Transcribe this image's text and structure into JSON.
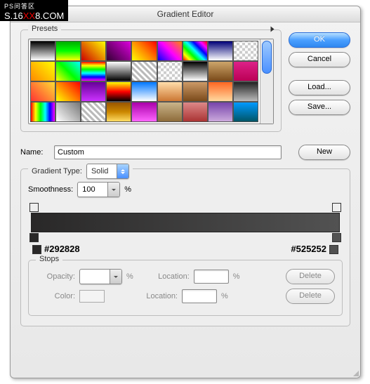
{
  "watermark": {
    "top": "PS问答区",
    "bottom_a": "S.16",
    "bottom_b": "XX",
    "bottom_c": "8.COM"
  },
  "title": "Gradient Editor",
  "buttons": {
    "ok": "OK",
    "cancel": "Cancel",
    "load": "Load...",
    "save": "Save...",
    "new": "New",
    "delete": "Delete"
  },
  "labels": {
    "presets": "Presets",
    "name": "Name:",
    "gradient_type": "Gradient Type:",
    "smoothness": "Smoothness:",
    "stops": "Stops",
    "opacity": "Opacity:",
    "color": "Color:",
    "location": "Location:",
    "pct": "%"
  },
  "name_value": "Custom",
  "gradient_type_value": "Solid",
  "smoothness_value": "100",
  "hex_left": "#292828",
  "hex_right": "#525252",
  "stops": {
    "opacity_value": "",
    "opacity_location": "",
    "color_value": "",
    "color_location": ""
  },
  "preset_gradients": [
    "linear-gradient(#000,#fff)",
    "linear-gradient(#0a0,#0f0,#ff0)",
    "linear-gradient(45deg,#c00,#ff0)",
    "linear-gradient(45deg,#303,#d0d)",
    "linear-gradient(45deg,#ff0,#f80,#f00)",
    "linear-gradient(45deg,#00f,#f0f,#f80)",
    "linear-gradient(45deg,#f00,#ff0,#0f0,#0ff,#00f,#f0f,#f00)",
    "linear-gradient(#007,#fff)",
    "repeating-conic-gradient(#ccc 0 25%,#fff 0 50%) 0/8px 8px",
    "linear-gradient(45deg,#f80,#ff0)",
    "linear-gradient(45deg,#ff0,#0f0,#0ff)",
    "linear-gradient(#f00,#ff0,#0f0,#0ff,#00f,#f0f)",
    "linear-gradient(#fff,#000)",
    "repeating-linear-gradient(45deg,#bbb 0 3px,#fff 3px 6px)",
    "repeating-conic-gradient(#ccc 0 25%,#fff 0 50%) 0/8px 8px",
    "linear-gradient(#000,#fff)",
    "linear-gradient(#cda56a,#7a4a1a)",
    "linear-gradient(#d28,#b05)",
    "linear-gradient(45deg,#f33,#fd3)",
    "linear-gradient(45deg,#ff0,#f00)",
    "linear-gradient(#609,#c3f)",
    "linear-gradient(#ff0,#f00,#000)",
    "linear-gradient(#07f,#fff)",
    "linear-gradient(#ffddaa,#cc7733)",
    "linear-gradient(#c96,#7a4a1a)",
    "linear-gradient(#f62,#ffd9a0)",
    "linear-gradient(#222,#bbb)",
    "linear-gradient(to right,#f00,#ff0,#0f0,#0ff,#00f,#f0f)",
    "linear-gradient(45deg,#fff,#777)",
    "repeating-linear-gradient(45deg,#bbb 0 3px,#fff 3px 6px)",
    "linear-gradient(#950,#c80,#fd6)",
    "linear-gradient(#a0a,#f6f)",
    "linear-gradient(#c9b48a,#8d6b3a)",
    "linear-gradient(#d88,#a33)",
    "linear-gradient(#74a,#cad)",
    "linear-gradient(#09f,#056)"
  ]
}
